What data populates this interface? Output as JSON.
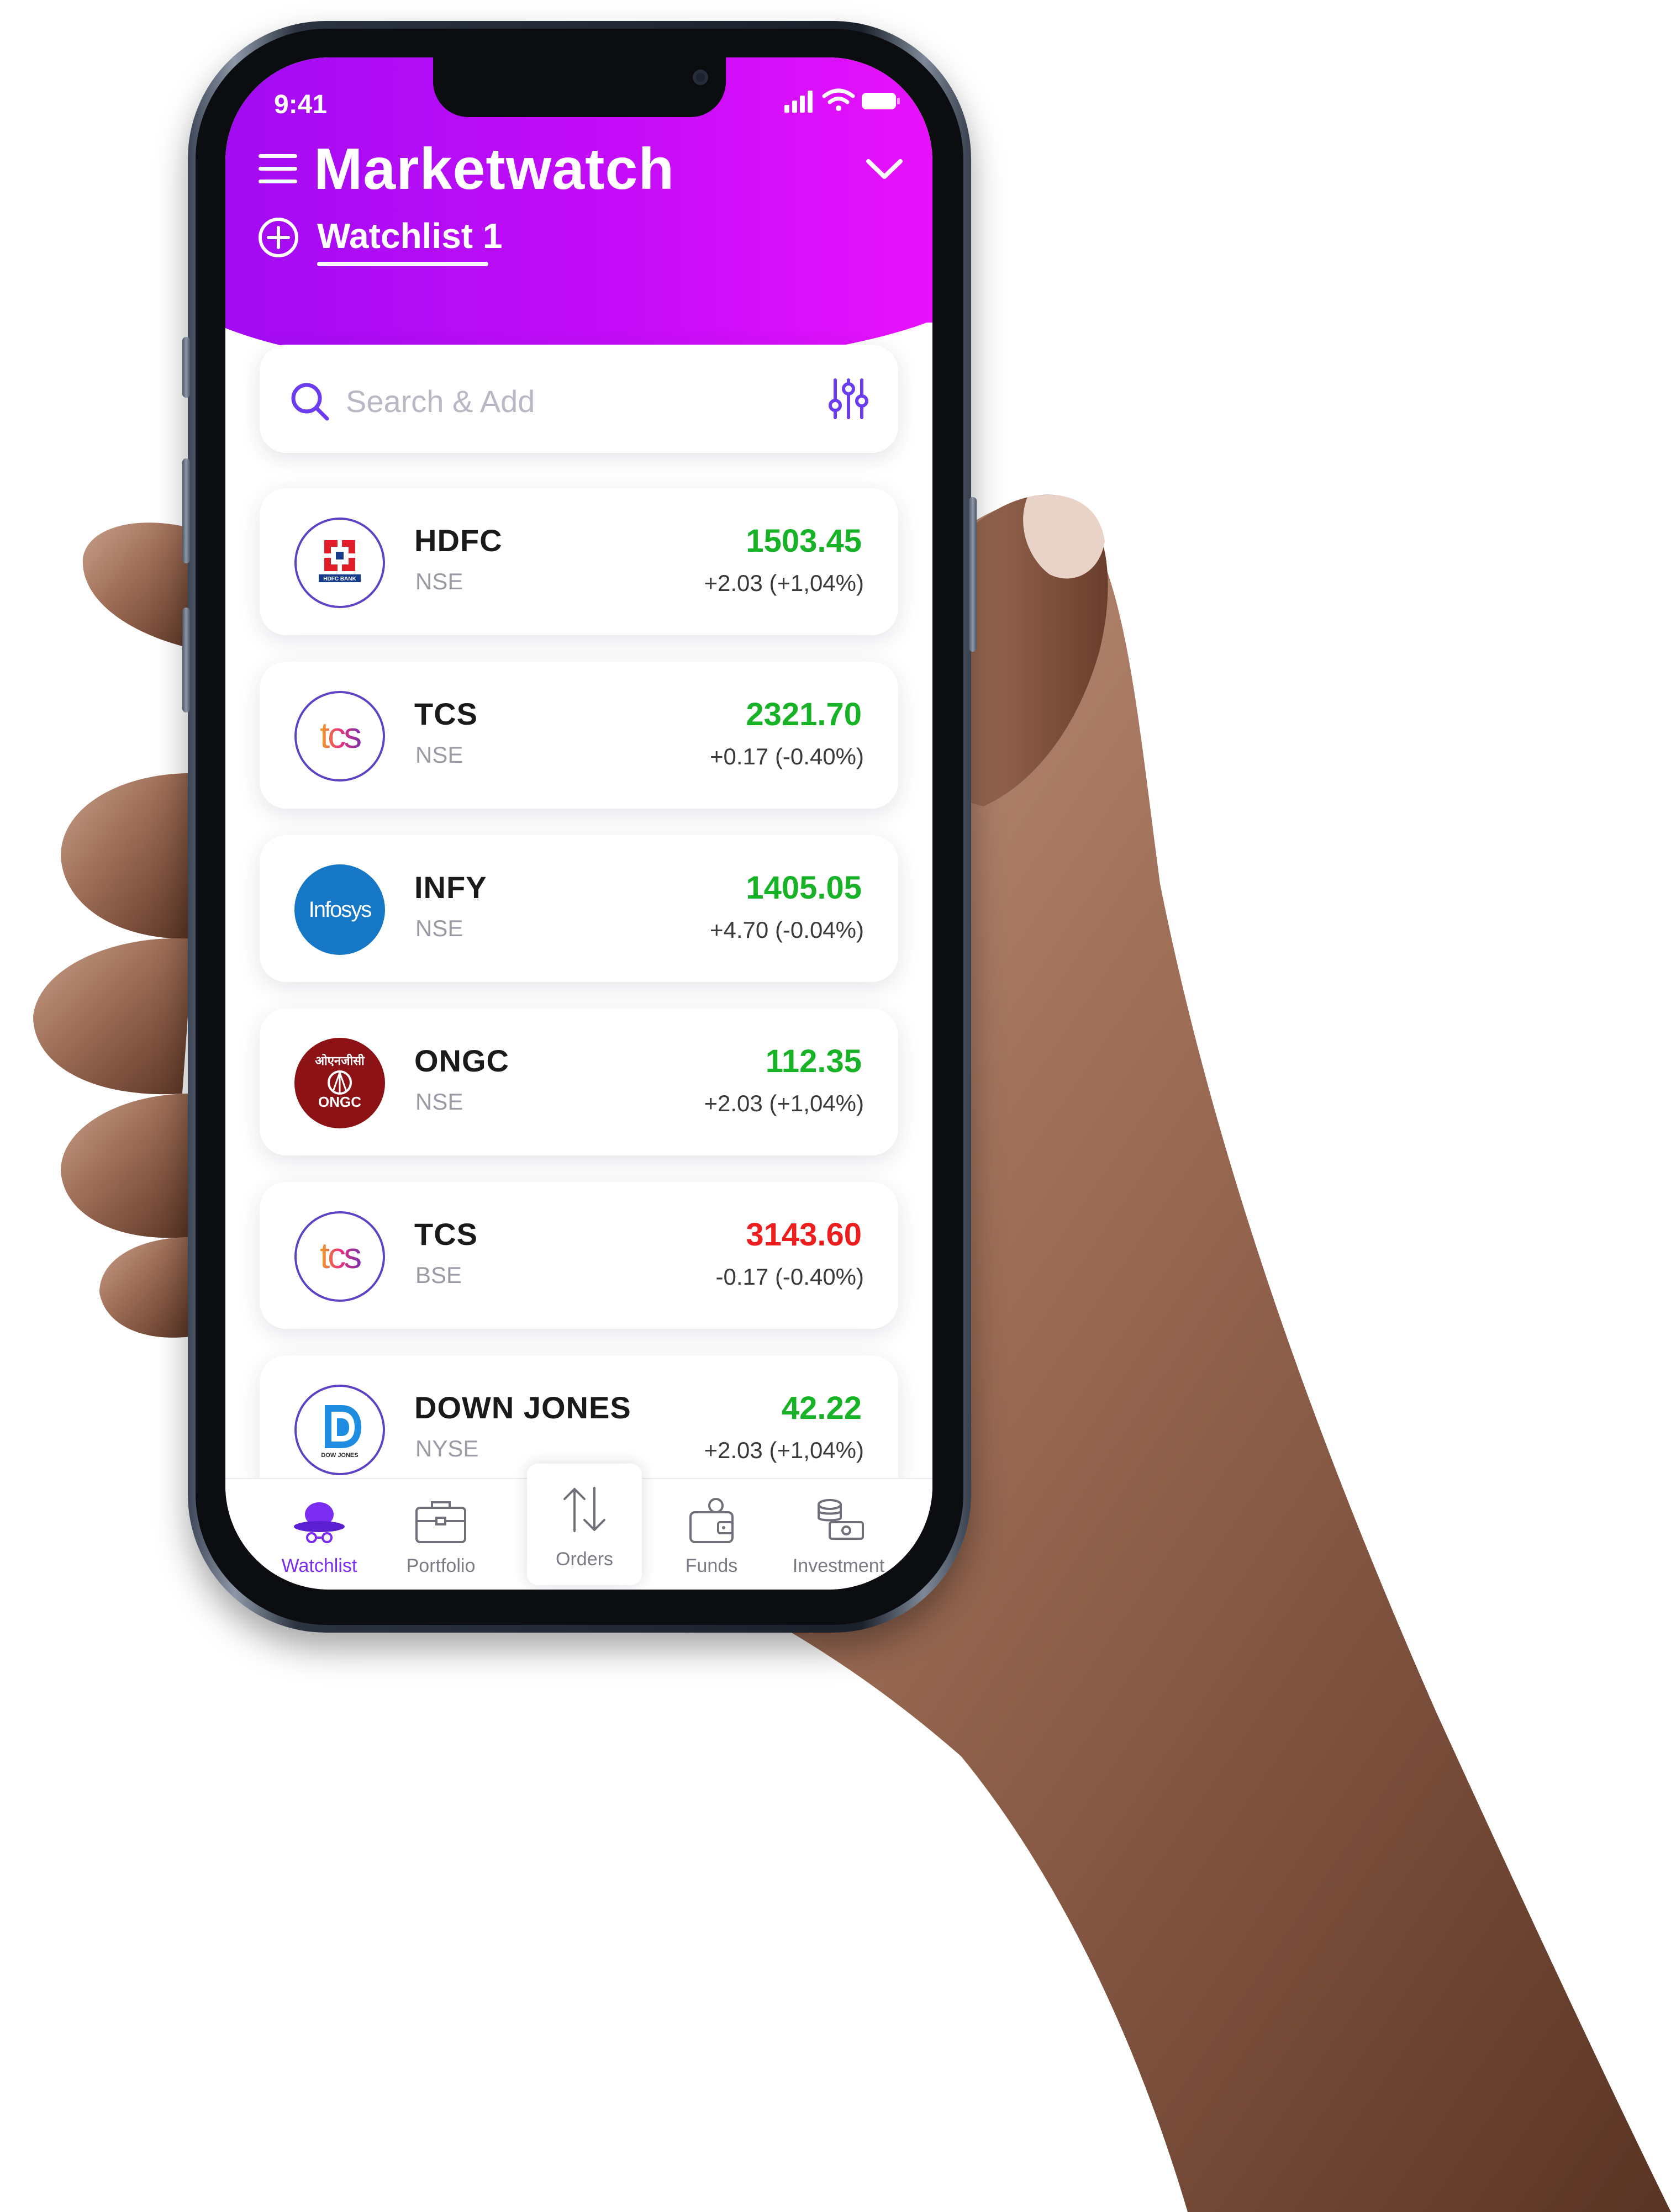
{
  "status_bar": {
    "time": "9:41"
  },
  "header": {
    "title": "Marketwatch",
    "active_watchlist": "Watchlist 1"
  },
  "search": {
    "placeholder": "Search & Add"
  },
  "stocks": [
    {
      "symbol": "HDFC",
      "exchange": "NSE",
      "price": "1503.45",
      "change": "+2.03 (+1,04%)",
      "trend": "up",
      "logo": "hdfc-bank-logo"
    },
    {
      "symbol": "TCS",
      "exchange": "NSE",
      "price": "2321.70",
      "change": "+0.17 (-0.40%)",
      "trend": "up",
      "logo": "tcs-logo"
    },
    {
      "symbol": "INFY",
      "exchange": "NSE",
      "price": "1405.05",
      "change": "+4.70 (-0.04%)",
      "trend": "up",
      "logo": "infosys-logo"
    },
    {
      "symbol": "ONGC",
      "exchange": "NSE",
      "price": "112.35",
      "change": "+2.03 (+1,04%)",
      "trend": "up",
      "logo": "ongc-logo"
    },
    {
      "symbol": "TCS",
      "exchange": "BSE",
      "price": "3143.60",
      "change": "-0.17 (-0.40%)",
      "trend": "down",
      "logo": "tcs-logo"
    },
    {
      "symbol": "DOWN JONES",
      "exchange": "NYSE",
      "price": "42.22",
      "change": "+2.03 (+1,04%)",
      "trend": "up",
      "logo": "dow-jones-logo"
    }
  ],
  "logo_text": {
    "hdfc": "HDFC BANK",
    "tcs": "tcs",
    "infosys": "Infosys",
    "ongc_hindi": "ओएनजीसी",
    "ongc": "ONGC",
    "dow": "DOW JONES"
  },
  "bottom_nav": [
    {
      "label": "Watchlist",
      "icon": "watchlist-hat-icon",
      "active": true
    },
    {
      "label": "Portfolio",
      "icon": "briefcase-icon",
      "active": false
    },
    {
      "label": "Orders",
      "icon": "up-down-arrows-icon",
      "active": false
    },
    {
      "label": "Funds",
      "icon": "wallet-icon",
      "active": false
    },
    {
      "label": "Investment",
      "icon": "money-stack-icon",
      "active": false
    }
  ],
  "colors": {
    "header_gradient": [
      "#a20bf3",
      "#e812fc"
    ],
    "accent": "#7a2cf0",
    "price_up": "#17b226",
    "price_down": "#ef1e1e"
  }
}
